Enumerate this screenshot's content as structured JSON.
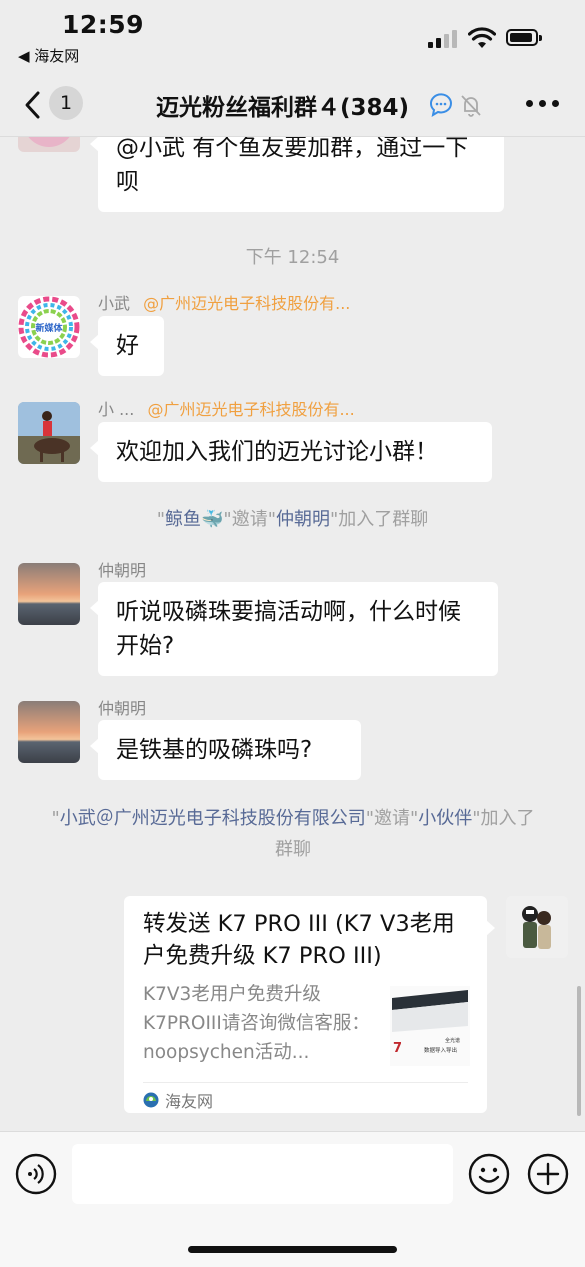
{
  "status_bar": {
    "time": "12:59",
    "back_app": "◀ 海友网"
  },
  "nav": {
    "unread": "1",
    "title": "迈光粉丝福利群４(384)"
  },
  "messages": {
    "prev_bubble": "@小武 有个鱼友要加群，通过一下呗",
    "timestamp": "下午 12:54",
    "msg1": {
      "sender": "小武",
      "sender_at": "@广州迈光电子科技股份有...",
      "text": "好",
      "avatar_label": "新媒体"
    },
    "msg2": {
      "sender": "小 ...",
      "sender_at": "@广州迈光电子科技股份有...",
      "text": "欢迎加入我们的迈光讨论小群！"
    },
    "sys1": {
      "q1": "\"",
      "inviter": "鲸鱼🐳",
      "mid": "\"邀请\"",
      "invitee": "仲朝明",
      "tail": "\"加入了群聊"
    },
    "msg3": {
      "sender": "仲朝明",
      "text": "听说吸磷珠要搞活动啊，什么时候开始?"
    },
    "msg4": {
      "sender": "仲朝明",
      "text": "是铁基的吸磷珠吗?"
    },
    "sys2": {
      "q1": "\"",
      "inviter": "小武＠广州迈光电子科技股份有限公司",
      "mid": "\"邀请\"",
      "invitee": "小伙伴",
      "tail": "\"加入了群聊"
    },
    "link_card": {
      "title": "转发送 K7 PRO III (K7 V3老用户免费升级 K7 PRO III)",
      "desc": "K7V3老用户免费升级K7PROIII请咨询微信客服：noopsychen活动...",
      "thumb_text1": "7",
      "thumb_text2": "数据导入导出",
      "thumb_text3": "全光谱",
      "source": "海友网"
    }
  },
  "input": {
    "placeholder": ""
  }
}
